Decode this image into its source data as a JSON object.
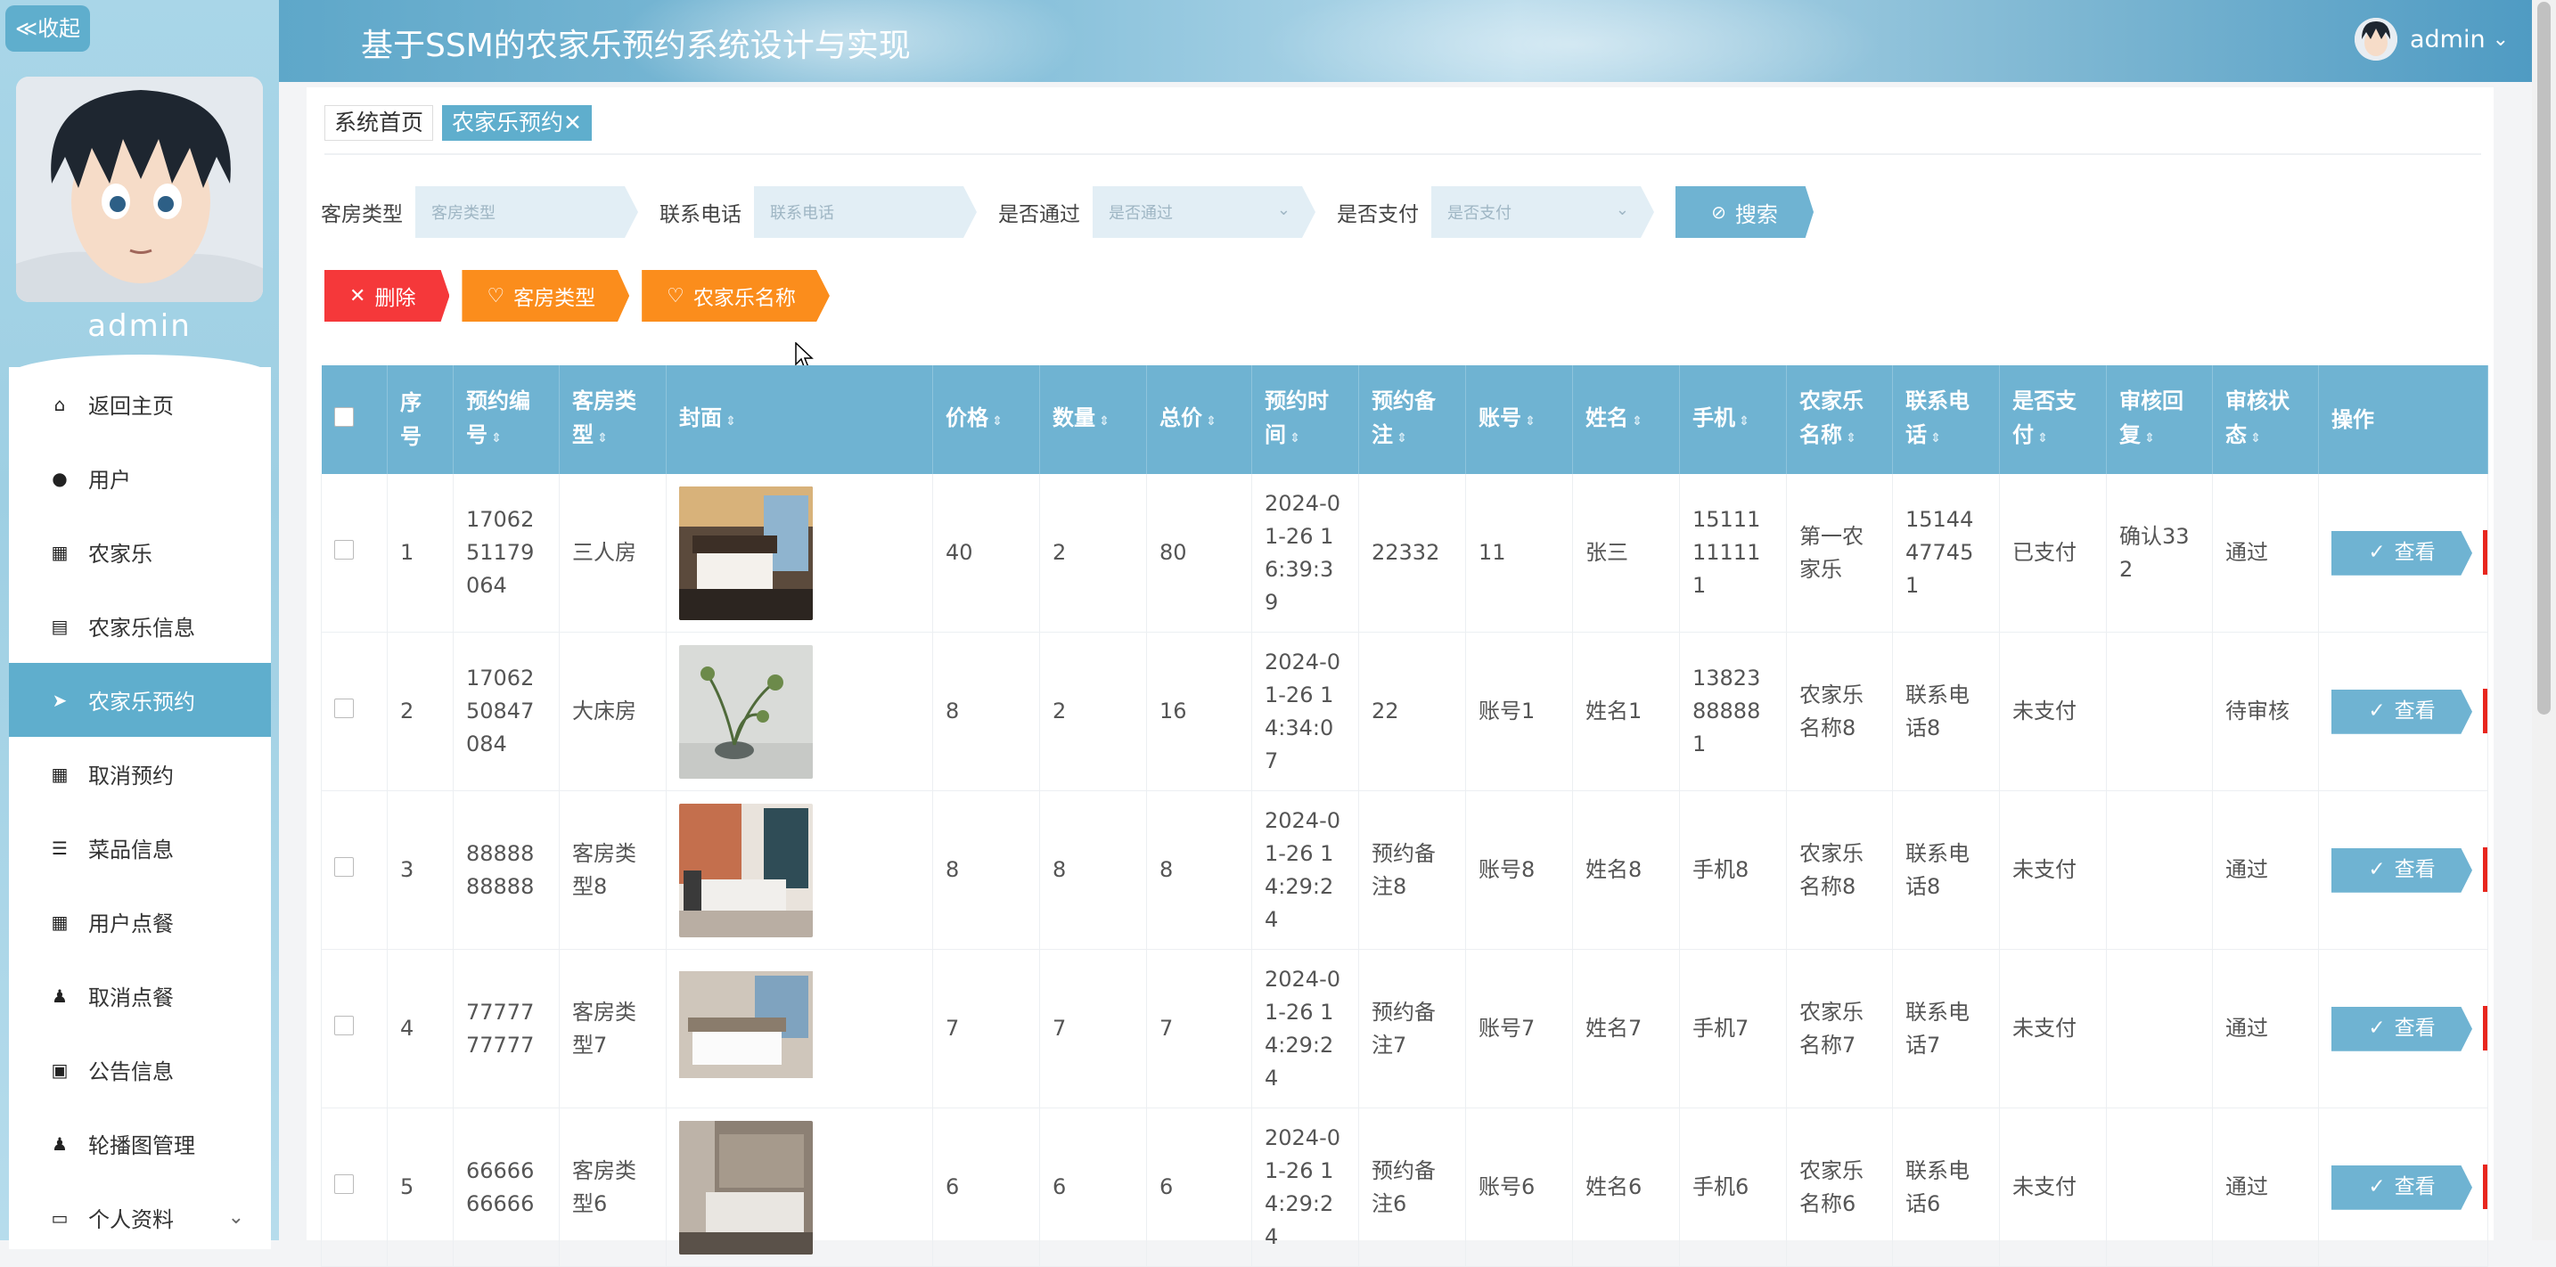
{
  "sidebar": {
    "collapse_label": "≪收起",
    "username": "admin",
    "items": [
      {
        "label": "返回主页",
        "icon": "home-icon",
        "glyph": "⌂"
      },
      {
        "label": "用户",
        "icon": "pin-icon",
        "glyph": "●"
      },
      {
        "label": "农家乐",
        "icon": "grid-icon",
        "glyph": "▦"
      },
      {
        "label": "农家乐信息",
        "icon": "clipboard-icon",
        "glyph": "▤"
      },
      {
        "label": "农家乐预约",
        "icon": "send-icon",
        "glyph": "➤"
      },
      {
        "label": "取消预约",
        "icon": "grid-icon",
        "glyph": "▦"
      },
      {
        "label": "菜品信息",
        "icon": "list-icon",
        "glyph": "☰"
      },
      {
        "label": "用户点餐",
        "icon": "grid-icon",
        "glyph": "▦"
      },
      {
        "label": "取消点餐",
        "icon": "person-icon",
        "glyph": "♟"
      },
      {
        "label": "公告信息",
        "icon": "calendar-check-icon",
        "glyph": "▣"
      },
      {
        "label": "轮播图管理",
        "icon": "user-icon",
        "glyph": "♟"
      },
      {
        "label": "个人资料",
        "icon": "card-icon",
        "glyph": "▭",
        "chevron": "⌄"
      }
    ]
  },
  "header": {
    "title": "基于SSM的农家乐预约系统设计与实现",
    "username": "admin",
    "chevron": "⌄"
  },
  "tabs": [
    {
      "label": "系统首页"
    },
    {
      "label": "农家乐预约",
      "close": "✕"
    }
  ],
  "search": {
    "fields": [
      {
        "label": "客房类型",
        "placeholder": "客房类型"
      },
      {
        "label": "联系电话",
        "placeholder": "联系电话"
      },
      {
        "label": "是否通过",
        "placeholder": "是否通过",
        "dropdown": "⌄"
      },
      {
        "label": "是否支付",
        "placeholder": "是否支付",
        "dropdown": "⌄"
      }
    ],
    "button": {
      "label": "搜索",
      "icon": "⊘"
    }
  },
  "actions": [
    {
      "label": "删除",
      "icon": "✕"
    },
    {
      "label": "客房类型",
      "icon": "♡"
    },
    {
      "label": "农家乐名称",
      "icon": "♡"
    }
  ],
  "table": {
    "headers": [
      "序号",
      "预约编号",
      "客房类型",
      "封面",
      "价格",
      "数量",
      "总价",
      "预约时间",
      "预约备注",
      "账号",
      "姓名",
      "手机",
      "农家乐名称",
      "联系电话",
      "是否支付",
      "审核回复",
      "审核状态",
      "操作"
    ],
    "view_label": "查看",
    "view_icon": "✓",
    "rows": [
      {
        "no": "1",
        "order_no": "1706251179064",
        "room_type": "三人房",
        "price": "40",
        "qty": "2",
        "total": "80",
        "time": "2024-01-26 16:39:39",
        "note": "22332",
        "account": "11",
        "name": "张三",
        "phone": "15111111111",
        "farm": "第一农家乐",
        "tel": "15144477451",
        "paid": "已支付",
        "reply": "确认332",
        "status": "通过"
      },
      {
        "no": "2",
        "order_no": "1706250847084",
        "room_type": "大床房",
        "price": "8",
        "qty": "2",
        "total": "16",
        "time": "2024-01-26 14:34:07",
        "note": "22",
        "account": "账号1",
        "name": "姓名1",
        "phone": "13823888881",
        "farm": "农家乐名称8",
        "tel": "联系电话8",
        "paid": "未支付",
        "reply": "",
        "status": "待审核"
      },
      {
        "no": "3",
        "order_no": "8888888888",
        "room_type": "客房类型8",
        "price": "8",
        "qty": "8",
        "total": "8",
        "time": "2024-01-26 14:29:24",
        "note": "预约备注8",
        "account": "账号8",
        "name": "姓名8",
        "phone": "手机8",
        "farm": "农家乐名称8",
        "tel": "联系电话8",
        "paid": "未支付",
        "reply": "",
        "status": "通过"
      },
      {
        "no": "4",
        "order_no": "7777777777",
        "room_type": "客房类型7",
        "price": "7",
        "qty": "7",
        "total": "7",
        "time": "2024-01-26 14:29:24",
        "note": "预约备注7",
        "account": "账号7",
        "name": "姓名7",
        "phone": "手机7",
        "farm": "农家乐名称7",
        "tel": "联系电话7",
        "paid": "未支付",
        "reply": "",
        "status": "通过"
      },
      {
        "no": "5",
        "order_no": "6666666666",
        "room_type": "客房类型6",
        "price": "6",
        "qty": "6",
        "total": "6",
        "time": "2024-01-26 14:29:24",
        "note": "预约备注6",
        "account": "账号6",
        "name": "姓名6",
        "phone": "手机6",
        "farm": "农家乐名称6",
        "tel": "联系电话6",
        "paid": "未支付",
        "reply": "",
        "status": "通过"
      }
    ]
  },
  "colors": {
    "accent": "#6fb3d2",
    "active_menu": "#5faecd",
    "delete": "#f5383a",
    "filter": "#fb8d1c"
  }
}
